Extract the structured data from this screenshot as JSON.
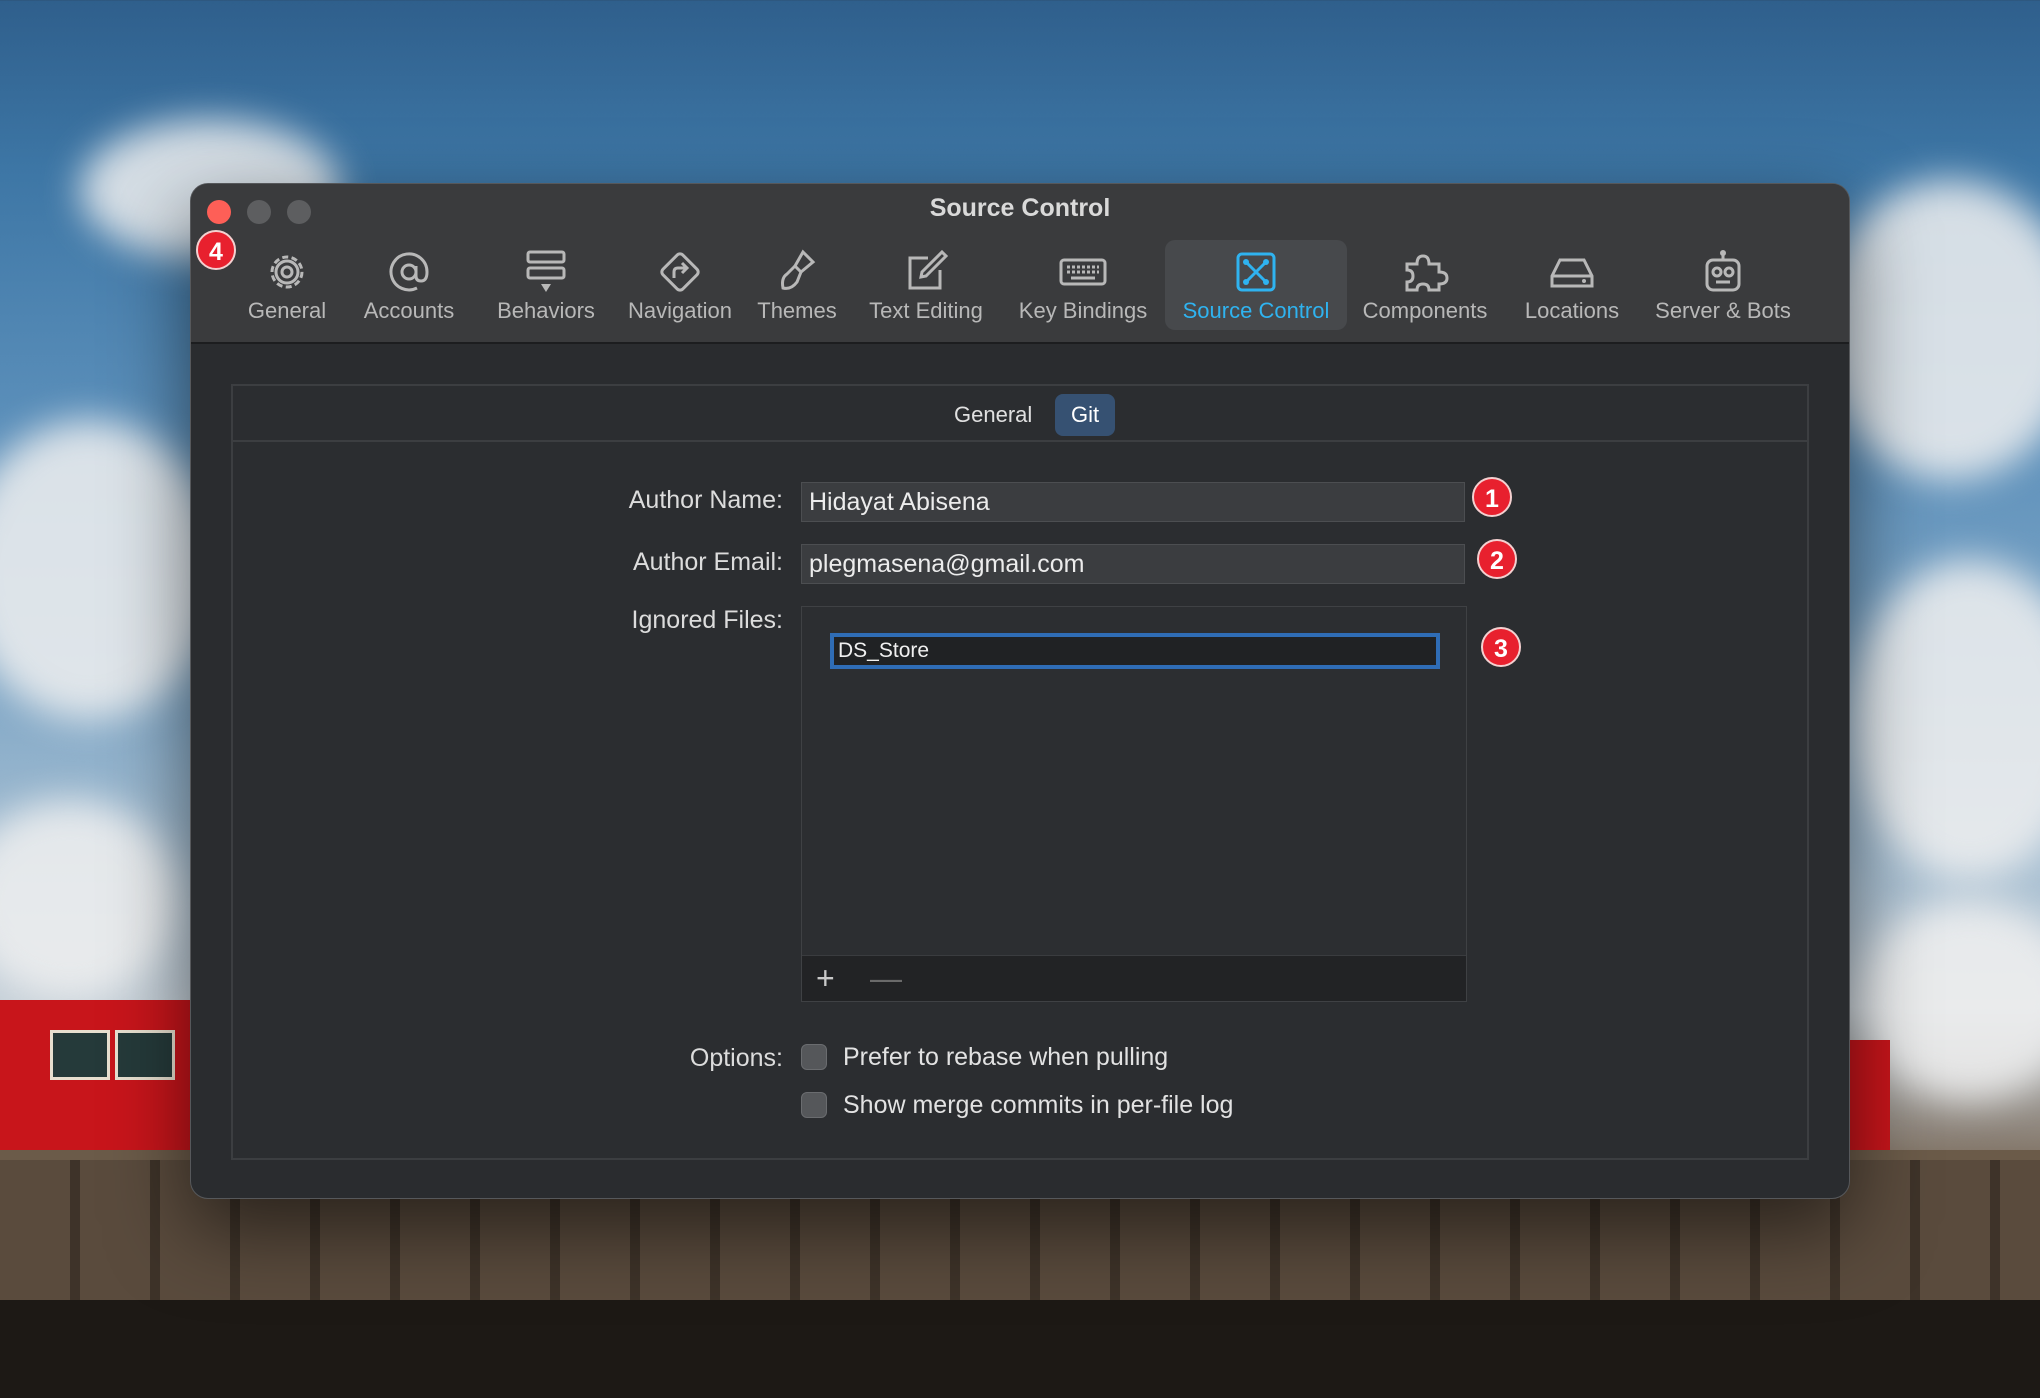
{
  "window": {
    "title": "Source Control"
  },
  "toolbar": {
    "selected": "Source Control",
    "items": [
      {
        "label": "General",
        "icon": "gear-icon"
      },
      {
        "label": "Accounts",
        "icon": "at-sign-icon"
      },
      {
        "label": "Behaviors",
        "icon": "behaviors-icon"
      },
      {
        "label": "Navigation",
        "icon": "navigation-icon"
      },
      {
        "label": "Themes",
        "icon": "paintbrush-icon"
      },
      {
        "label": "Text Editing",
        "icon": "pencil-square-icon"
      },
      {
        "label": "Key Bindings",
        "icon": "keyboard-icon"
      },
      {
        "label": "Source Control",
        "icon": "source-control-icon"
      },
      {
        "label": "Components",
        "icon": "puzzle-icon"
      },
      {
        "label": "Locations",
        "icon": "drive-icon"
      },
      {
        "label": "Server & Bots",
        "icon": "robot-icon"
      }
    ]
  },
  "tabs": {
    "items": [
      "General",
      "Git"
    ],
    "active": "Git"
  },
  "form": {
    "author_name_label": "Author Name:",
    "author_name_value": "Hidayat Abisena",
    "author_email_label": "Author Email:",
    "author_email_value": "plegmasena@gmail.com",
    "ignored_files_label": "Ignored Files:",
    "ignored_files": [
      "DS_Store"
    ],
    "add_symbol": "+",
    "remove_symbol": "—",
    "options_label": "Options:",
    "options": [
      {
        "label": "Prefer to rebase when pulling",
        "checked": false
      },
      {
        "label": "Show merge commits in per-file log",
        "checked": false
      }
    ]
  },
  "annotations": [
    "1",
    "2",
    "3",
    "4"
  ],
  "colors": {
    "accent": "#2fb3f0",
    "selected_segment": "#365172",
    "badge": "#e8202e",
    "close_button": "#fe5f57"
  }
}
